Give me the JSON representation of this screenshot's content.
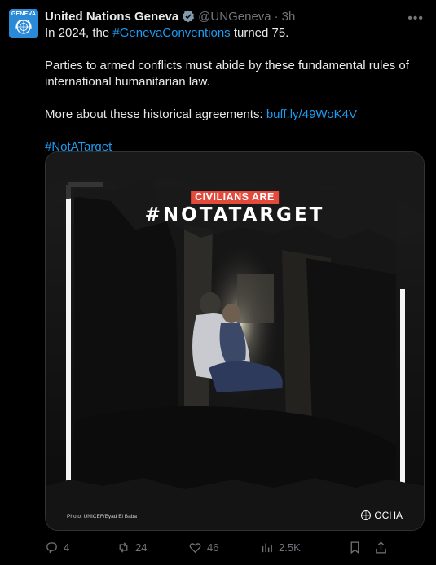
{
  "tweet": {
    "author_name": "United Nations Geneva",
    "handle": "@UNGeneva",
    "separator": "·",
    "time": "3h",
    "avatar_text": "GENEVA",
    "line1_prefix": "In 2024, the ",
    "line1_hashtag": "#GenevaConventions",
    "line1_suffix": " turned 75.",
    "para2": "Parties to armed conflicts must abide by these fundamental rules of international humanitarian law.",
    "para3_prefix": "More about these historical agreements: ",
    "para3_link": "buff.ly/49WoK4V",
    "hashtag": "#NotATarget"
  },
  "media": {
    "label": "CIVILIANS ARE",
    "title": "#NOTATARGET",
    "credit": "Photo: UNICEF/Eyad El Baba",
    "logo": "OCHA"
  },
  "actions": {
    "replies": "4",
    "reposts": "24",
    "likes": "46",
    "views": "2.5K"
  },
  "colors": {
    "background": "#000000",
    "text": "#e7e9ea",
    "muted": "#71767b",
    "link": "#1d9bf0",
    "label_red": "#e24a3b",
    "avatar_blue": "#2b8ad8"
  }
}
